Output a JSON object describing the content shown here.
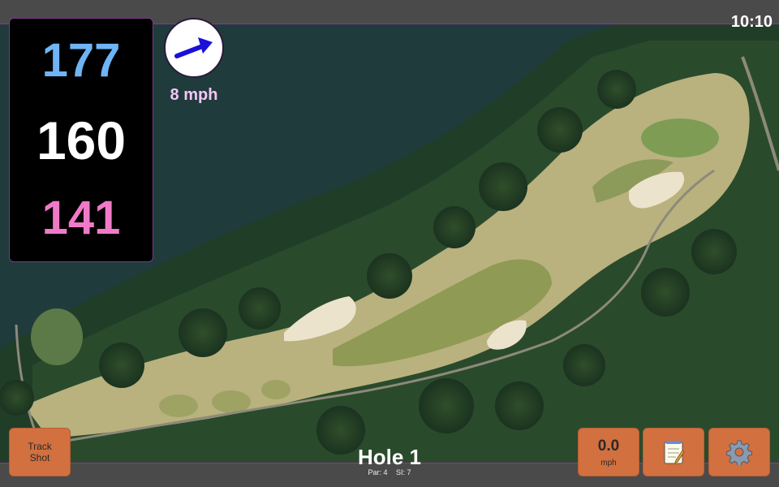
{
  "status_bar": {
    "time": "10:10"
  },
  "distances": {
    "back": "177",
    "middle": "160",
    "front": "141"
  },
  "wind": {
    "speed": "8 mph",
    "icon": "wind-arrow-icon",
    "arrow_color": "#1a10d8"
  },
  "track_button": {
    "line1": "Track",
    "line2": "Shot"
  },
  "hole": {
    "title": "Hole 1",
    "par": "Par: 4",
    "si": "SI: 7"
  },
  "speed_button": {
    "value": "0.0",
    "unit": "mph"
  },
  "notes_button": {
    "icon": "notepad-icon"
  },
  "settings_button": {
    "icon": "gear-icon"
  },
  "colors": {
    "back_distance": "#6fb4f5",
    "middle_distance": "#ffffff",
    "front_distance": "#f07ac8",
    "wind_text": "#f5c6f5",
    "button": "#d2703f",
    "panel_border": "#7a3a8a"
  }
}
